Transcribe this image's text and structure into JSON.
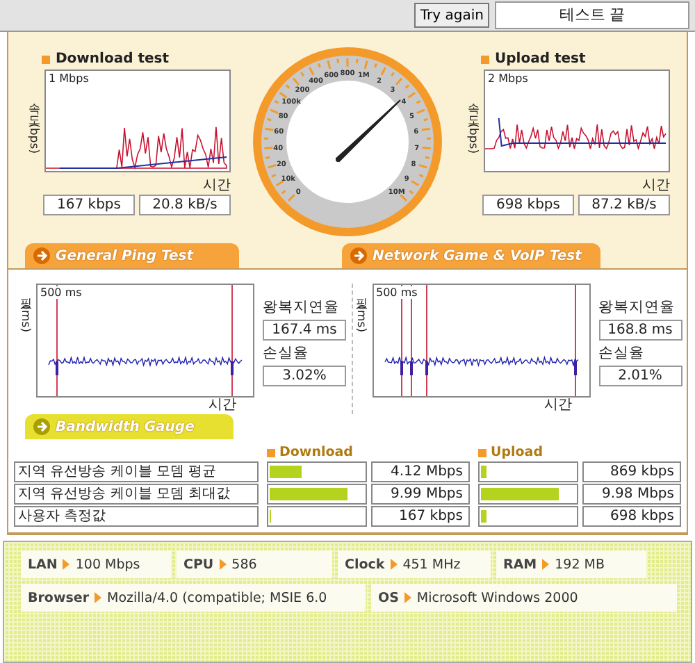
{
  "top_bar": {
    "button": "Try again",
    "status": "테스트 끝"
  },
  "download_test": {
    "title": "Download test",
    "y_label": "속도 (bps)",
    "scale": "1 Mbps",
    "x_label": "시간",
    "speed": "167 kbps",
    "rate": "20.8 kB/s"
  },
  "gauge": {
    "labels": [
      "0",
      "10k",
      "20",
      "40",
      "60",
      "80",
      "100k",
      "200",
      "400",
      "600",
      "800",
      "1M",
      "2",
      "3",
      "4",
      "5",
      "6",
      "7",
      "8",
      "9",
      "10M"
    ]
  },
  "upload_test": {
    "title": "Upload test",
    "y_label": "속도 (bps)",
    "scale": "2 Mbps",
    "x_label": "시간",
    "speed": "698 kbps",
    "rate": "87.2 kB/s"
  },
  "ping_tabs": [
    {
      "label": "General Ping Test"
    },
    {
      "label": "Network Game & VoIP Test"
    }
  ],
  "ping_tests": [
    {
      "y_label": "핑 (ms)",
      "scale": "500 ms",
      "x_label": "시간",
      "latency_label": "왕복지연율",
      "latency": "167.4 ms",
      "loss_label": "손실율",
      "loss": "3.02%"
    },
    {
      "y_label": "핑 (ms)",
      "scale": "500 ms",
      "x_label": "시간",
      "latency_label": "왕복지연율",
      "latency": "168.8 ms",
      "loss_label": "손실율",
      "loss": "2.01%"
    }
  ],
  "bandwidth": {
    "title": "Bandwidth Gauge",
    "columns": [
      "Download",
      "Upload"
    ],
    "rows": [
      {
        "label": "지역 유선방송 케이블 모뎀 평균",
        "download": {
          "level": 0.34,
          "value": "4.12 Mbps"
        },
        "upload": {
          "level": 0.06,
          "value": "869 kbps"
        }
      },
      {
        "label": "지역 유선방송 케이블 모뎀 최대값",
        "download": {
          "level": 0.82,
          "value": "9.99 Mbps"
        },
        "upload": {
          "level": 0.83,
          "value": "9.98 Mbps"
        }
      },
      {
        "label": "사용자 측정값",
        "download": {
          "level": 0,
          "value": "167 kbps"
        },
        "upload": {
          "level": 0.06,
          "value": "698 kbps"
        }
      }
    ]
  },
  "system_info": [
    [
      {
        "label": "LAN",
        "value": "100 Mbps"
      },
      {
        "label": "CPU",
        "value": "586"
      },
      {
        "label": "Clock",
        "value": "451 MHz"
      },
      {
        "label": "RAM",
        "value": "192 MB"
      }
    ],
    [
      {
        "label": "Browser",
        "value": "Mozilla/4.0 (compatible; MSIE 6.0"
      },
      {
        "label": "OS",
        "value": "Microsoft Windows 2000"
      }
    ]
  ]
}
